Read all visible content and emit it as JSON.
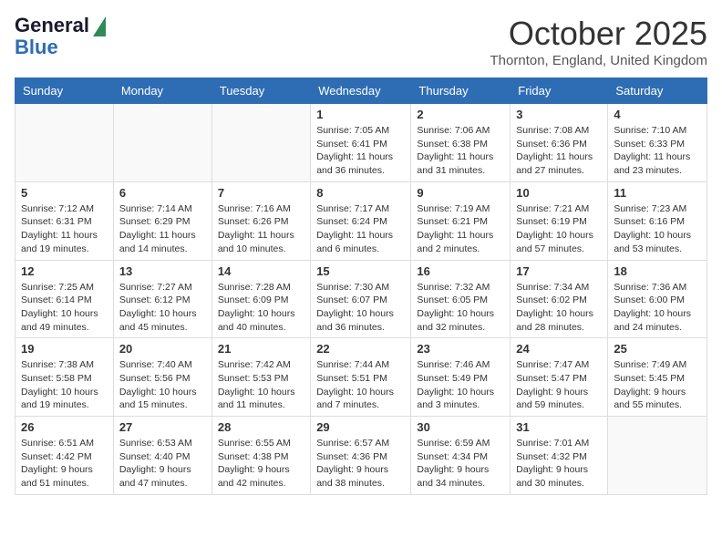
{
  "header": {
    "logo_line1": "General",
    "logo_line2": "Blue",
    "month": "October 2025",
    "location": "Thornton, England, United Kingdom"
  },
  "days_of_week": [
    "Sunday",
    "Monday",
    "Tuesday",
    "Wednesday",
    "Thursday",
    "Friday",
    "Saturday"
  ],
  "weeks": [
    [
      {
        "day": "",
        "info": ""
      },
      {
        "day": "",
        "info": ""
      },
      {
        "day": "",
        "info": ""
      },
      {
        "day": "1",
        "info": "Sunrise: 7:05 AM\nSunset: 6:41 PM\nDaylight: 11 hours\nand 36 minutes."
      },
      {
        "day": "2",
        "info": "Sunrise: 7:06 AM\nSunset: 6:38 PM\nDaylight: 11 hours\nand 31 minutes."
      },
      {
        "day": "3",
        "info": "Sunrise: 7:08 AM\nSunset: 6:36 PM\nDaylight: 11 hours\nand 27 minutes."
      },
      {
        "day": "4",
        "info": "Sunrise: 7:10 AM\nSunset: 6:33 PM\nDaylight: 11 hours\nand 23 minutes."
      }
    ],
    [
      {
        "day": "5",
        "info": "Sunrise: 7:12 AM\nSunset: 6:31 PM\nDaylight: 11 hours\nand 19 minutes."
      },
      {
        "day": "6",
        "info": "Sunrise: 7:14 AM\nSunset: 6:29 PM\nDaylight: 11 hours\nand 14 minutes."
      },
      {
        "day": "7",
        "info": "Sunrise: 7:16 AM\nSunset: 6:26 PM\nDaylight: 11 hours\nand 10 minutes."
      },
      {
        "day": "8",
        "info": "Sunrise: 7:17 AM\nSunset: 6:24 PM\nDaylight: 11 hours\nand 6 minutes."
      },
      {
        "day": "9",
        "info": "Sunrise: 7:19 AM\nSunset: 6:21 PM\nDaylight: 11 hours\nand 2 minutes."
      },
      {
        "day": "10",
        "info": "Sunrise: 7:21 AM\nSunset: 6:19 PM\nDaylight: 10 hours\nand 57 minutes."
      },
      {
        "day": "11",
        "info": "Sunrise: 7:23 AM\nSunset: 6:16 PM\nDaylight: 10 hours\nand 53 minutes."
      }
    ],
    [
      {
        "day": "12",
        "info": "Sunrise: 7:25 AM\nSunset: 6:14 PM\nDaylight: 10 hours\nand 49 minutes."
      },
      {
        "day": "13",
        "info": "Sunrise: 7:27 AM\nSunset: 6:12 PM\nDaylight: 10 hours\nand 45 minutes."
      },
      {
        "day": "14",
        "info": "Sunrise: 7:28 AM\nSunset: 6:09 PM\nDaylight: 10 hours\nand 40 minutes."
      },
      {
        "day": "15",
        "info": "Sunrise: 7:30 AM\nSunset: 6:07 PM\nDaylight: 10 hours\nand 36 minutes."
      },
      {
        "day": "16",
        "info": "Sunrise: 7:32 AM\nSunset: 6:05 PM\nDaylight: 10 hours\nand 32 minutes."
      },
      {
        "day": "17",
        "info": "Sunrise: 7:34 AM\nSunset: 6:02 PM\nDaylight: 10 hours\nand 28 minutes."
      },
      {
        "day": "18",
        "info": "Sunrise: 7:36 AM\nSunset: 6:00 PM\nDaylight: 10 hours\nand 24 minutes."
      }
    ],
    [
      {
        "day": "19",
        "info": "Sunrise: 7:38 AM\nSunset: 5:58 PM\nDaylight: 10 hours\nand 19 minutes."
      },
      {
        "day": "20",
        "info": "Sunrise: 7:40 AM\nSunset: 5:56 PM\nDaylight: 10 hours\nand 15 minutes."
      },
      {
        "day": "21",
        "info": "Sunrise: 7:42 AM\nSunset: 5:53 PM\nDaylight: 10 hours\nand 11 minutes."
      },
      {
        "day": "22",
        "info": "Sunrise: 7:44 AM\nSunset: 5:51 PM\nDaylight: 10 hours\nand 7 minutes."
      },
      {
        "day": "23",
        "info": "Sunrise: 7:46 AM\nSunset: 5:49 PM\nDaylight: 10 hours\nand 3 minutes."
      },
      {
        "day": "24",
        "info": "Sunrise: 7:47 AM\nSunset: 5:47 PM\nDaylight: 9 hours\nand 59 minutes."
      },
      {
        "day": "25",
        "info": "Sunrise: 7:49 AM\nSunset: 5:45 PM\nDaylight: 9 hours\nand 55 minutes."
      }
    ],
    [
      {
        "day": "26",
        "info": "Sunrise: 6:51 AM\nSunset: 4:42 PM\nDaylight: 9 hours\nand 51 minutes."
      },
      {
        "day": "27",
        "info": "Sunrise: 6:53 AM\nSunset: 4:40 PM\nDaylight: 9 hours\nand 47 minutes."
      },
      {
        "day": "28",
        "info": "Sunrise: 6:55 AM\nSunset: 4:38 PM\nDaylight: 9 hours\nand 42 minutes."
      },
      {
        "day": "29",
        "info": "Sunrise: 6:57 AM\nSunset: 4:36 PM\nDaylight: 9 hours\nand 38 minutes."
      },
      {
        "day": "30",
        "info": "Sunrise: 6:59 AM\nSunset: 4:34 PM\nDaylight: 9 hours\nand 34 minutes."
      },
      {
        "day": "31",
        "info": "Sunrise: 7:01 AM\nSunset: 4:32 PM\nDaylight: 9 hours\nand 30 minutes."
      },
      {
        "day": "",
        "info": ""
      }
    ]
  ]
}
